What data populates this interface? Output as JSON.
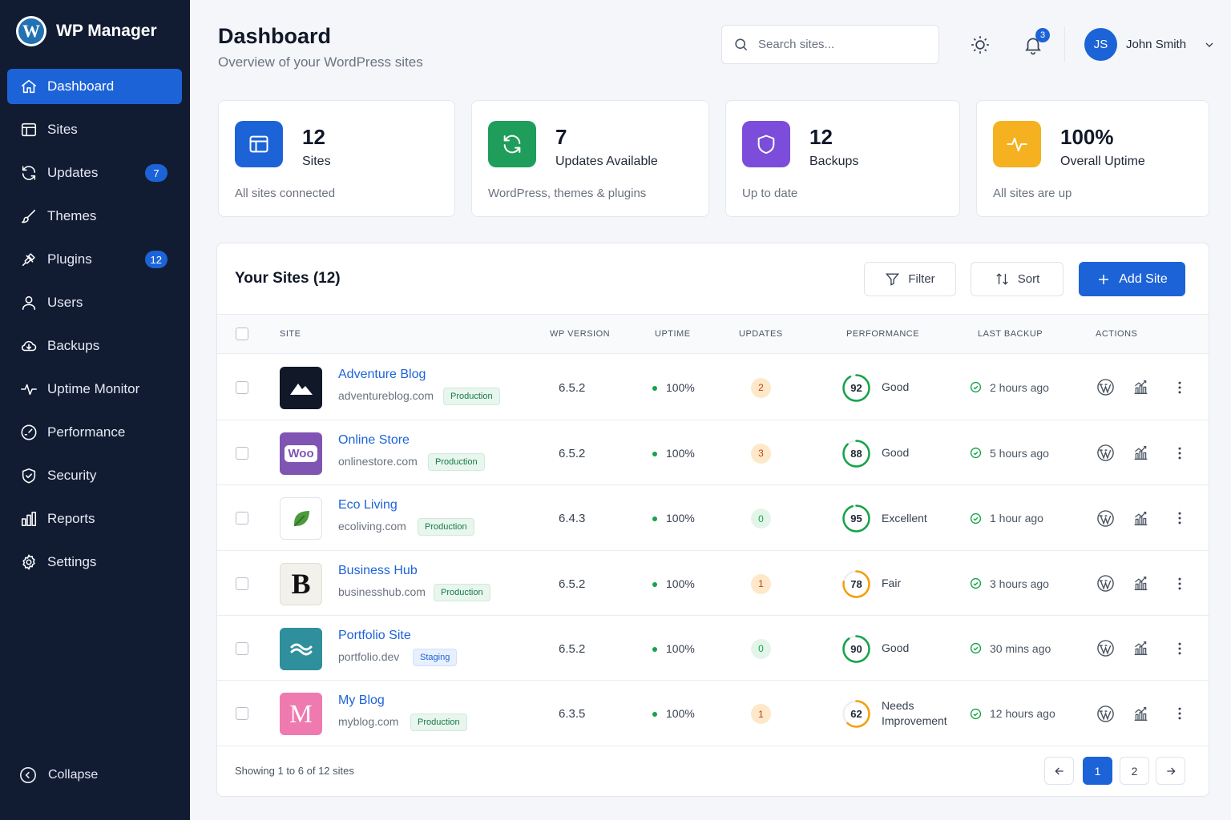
{
  "app": {
    "name": "WP Manager"
  },
  "sidebar": {
    "items": [
      {
        "label": "Dashboard",
        "icon": "home-icon",
        "active": true
      },
      {
        "label": "Sites",
        "icon": "browser-window-icon"
      },
      {
        "label": "Updates",
        "icon": "refresh-icon",
        "badge": "7"
      },
      {
        "label": "Themes",
        "icon": "brush-icon"
      },
      {
        "label": "Plugins",
        "icon": "plug-icon",
        "badge": "12"
      },
      {
        "label": "Users",
        "icon": "user-icon"
      },
      {
        "label": "Backups",
        "icon": "cloud-icon"
      },
      {
        "label": "Uptime Monitor",
        "icon": "pulse-icon"
      },
      {
        "label": "Performance",
        "icon": "gauge-icon"
      },
      {
        "label": "Security",
        "icon": "shield-check-icon"
      },
      {
        "label": "Reports",
        "icon": "bar-chart-icon"
      },
      {
        "label": "Settings",
        "icon": "gear-icon"
      }
    ],
    "collapse_label": "Collapse"
  },
  "header": {
    "title": "Dashboard",
    "subtitle": "Overview of your WordPress sites",
    "search_placeholder": "Search sites...",
    "notification_count": "3",
    "user_initials": "JS",
    "user_name": "John Smith"
  },
  "stats": [
    {
      "value": "12",
      "label": "Sites",
      "footnote": "All sites connected",
      "color": "#1d63d8",
      "icon": "browser-window-icon"
    },
    {
      "value": "7",
      "label": "Updates Available",
      "footnote": "WordPress, themes & plugins",
      "color": "#1e9e5a",
      "icon": "refresh-icon"
    },
    {
      "value": "12",
      "label": "Backups",
      "footnote": "Up to date",
      "color": "#7c4ddb",
      "icon": "shield-icon"
    },
    {
      "value": "100%",
      "label": "Overall Uptime",
      "footnote": "All sites are up",
      "color": "#f5b120",
      "icon": "pulse-icon"
    }
  ],
  "sites_panel": {
    "title": "Your Sites (12)",
    "filter_label": "Filter",
    "sort_label": "Sort",
    "add_label": "Add Site",
    "columns": [
      "SITE",
      "WP VERSION",
      "UPTIME",
      "UPDATES",
      "PERFORMANCE",
      "LAST BACKUP",
      "ACTIONS"
    ],
    "rows": [
      {
        "name": "Adventure Blog",
        "url": "adventureblog.com",
        "env": "Production",
        "env_type": "prod",
        "wp_version": "6.5.2",
        "uptime": "100%",
        "updates": "2",
        "score": "92",
        "score_pct": 0.92,
        "score_color": "#16a34a",
        "rating": "Good",
        "backup": "2 hours ago",
        "logo": "mountain"
      },
      {
        "name": "Online Store",
        "url": "onlinestore.com",
        "env": "Production",
        "env_type": "prod",
        "wp_version": "6.5.2",
        "uptime": "100%",
        "updates": "3",
        "score": "88",
        "score_pct": 0.88,
        "score_color": "#16a34a",
        "rating": "Good",
        "backup": "5 hours ago",
        "logo": "woo",
        "logo_text": "Woo"
      },
      {
        "name": "Eco Living",
        "url": "ecoliving.com",
        "env": "Production",
        "env_type": "prod",
        "wp_version": "6.4.3",
        "uptime": "100%",
        "updates": "0",
        "score": "95",
        "score_pct": 0.95,
        "score_color": "#16a34a",
        "rating": "Excellent",
        "backup": "1 hour ago",
        "logo": "leaf"
      },
      {
        "name": "Business Hub",
        "url": "businesshub.com",
        "env": "Production",
        "env_type": "prod",
        "wp_version": "6.5.2",
        "uptime": "100%",
        "updates": "1",
        "score": "78",
        "score_pct": 0.78,
        "score_color": "#f59e0b",
        "rating": "Fair",
        "backup": "3 hours ago",
        "logo": "letter-b",
        "logo_text": "B"
      },
      {
        "name": "Portfolio Site",
        "url": "portfolio.dev",
        "env": "Staging",
        "env_type": "stage",
        "wp_version": "6.5.2",
        "uptime": "100%",
        "updates": "0",
        "score": "90",
        "score_pct": 0.9,
        "score_color": "#16a34a",
        "rating": "Good",
        "backup": "30 mins ago",
        "logo": "wave"
      },
      {
        "name": "My Blog",
        "url": "myblog.com",
        "env": "Production",
        "env_type": "prod",
        "wp_version": "6.3.5",
        "uptime": "100%",
        "updates": "1",
        "score": "62",
        "score_pct": 0.62,
        "score_color": "#f59e0b",
        "rating": "Needs Improvement",
        "rating_lines": [
          "Needs",
          "Improvement"
        ],
        "backup": "12 hours ago",
        "logo": "letter-m",
        "logo_text": "M"
      }
    ],
    "showing_text": "Showing 1 to 6 of 12 sites",
    "pages": [
      "1",
      "2"
    ],
    "current_page": "1"
  }
}
